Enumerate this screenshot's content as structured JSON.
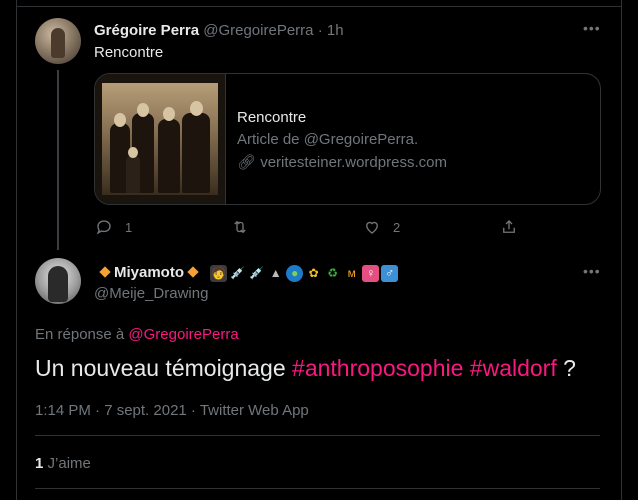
{
  "tweet1": {
    "name": "Grégoire Perra",
    "handle": "@GregoirePerra",
    "dot": "·",
    "time": "1h",
    "text": "Rencontre",
    "card": {
      "title": "Rencontre",
      "subtitle": "Article de @GregoirePerra.",
      "link": "veritesteiner.wordpress.com"
    },
    "actions": {
      "reply_count": "1",
      "retweet_count": "",
      "like_count": "2"
    }
  },
  "tweet2": {
    "name": "Miyamoto",
    "handle": "@Meije_Drawing",
    "replying_prefix": "En réponse à",
    "replying_to": "@GregoirePerra",
    "text_plain": "Un nouveau témoignage",
    "hashtag1": "#anthroposophie",
    "hashtag2": "#waldorf",
    "text_end": "?",
    "timestamp": "1:14 PM · 7 sept. 2021 · Twitter Web App",
    "like_count": "1",
    "like_label": "J’aime"
  },
  "icons": {
    "more": "more-icon",
    "reply": "reply-icon",
    "retweet": "retweet-icon",
    "like": "heart-icon",
    "share": "share-icon",
    "link": "link-icon"
  },
  "colors": {
    "background": "#000000",
    "text": "#e7e9ea",
    "muted": "#71767b",
    "border": "#2f3336",
    "hashtag": "#f91880"
  }
}
